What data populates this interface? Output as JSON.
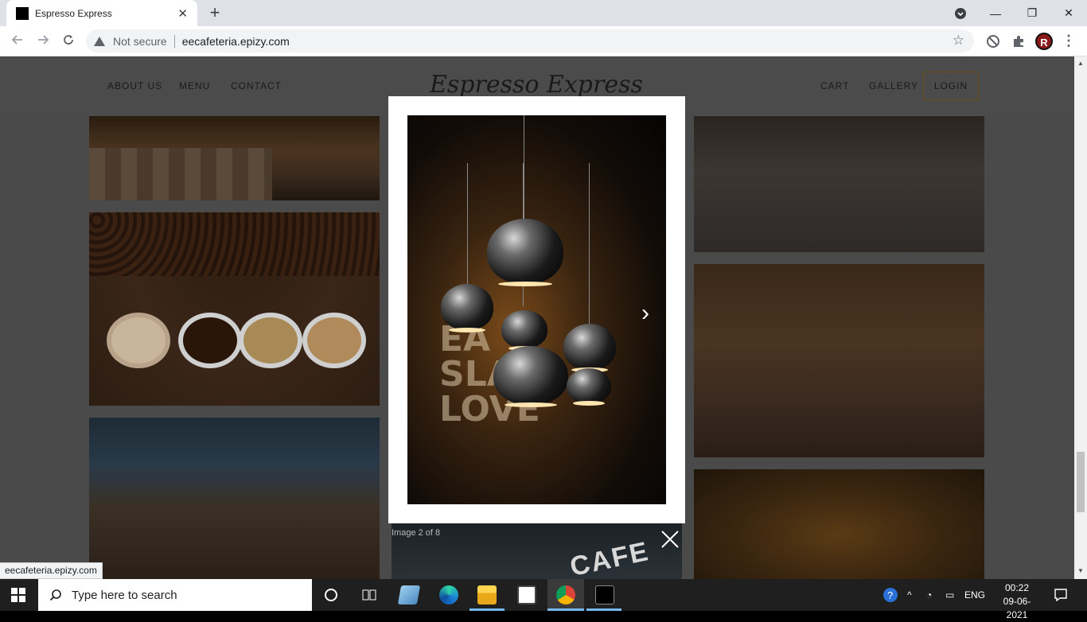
{
  "browser": {
    "tab_title": "Espresso Express",
    "tab_close": "✕",
    "new_tab": "+",
    "not_secure": "Not secure",
    "url": "eecafeteria.epizy.com",
    "profile_initial": "R",
    "window_controls": {
      "minimize": "—",
      "restore": "❐",
      "close": "✕"
    }
  },
  "site": {
    "logo": "Espresso Express",
    "nav_left": [
      "ABOUT US",
      "MENU",
      "CONTACT"
    ],
    "nav_right": [
      "CART",
      "GALLERY"
    ],
    "login": "LOGIN"
  },
  "lightbox": {
    "caption": "Image 2 of 8",
    "sign_text": "EA\nSLA\nLOVE",
    "next": "›"
  },
  "background_sign": "CAFE",
  "status_bar": "eecafeteria.epizy.com",
  "taskbar": {
    "search_placeholder": "Type here to search",
    "language": "ENG",
    "time": "00:22",
    "date": "09-06-2021"
  }
}
